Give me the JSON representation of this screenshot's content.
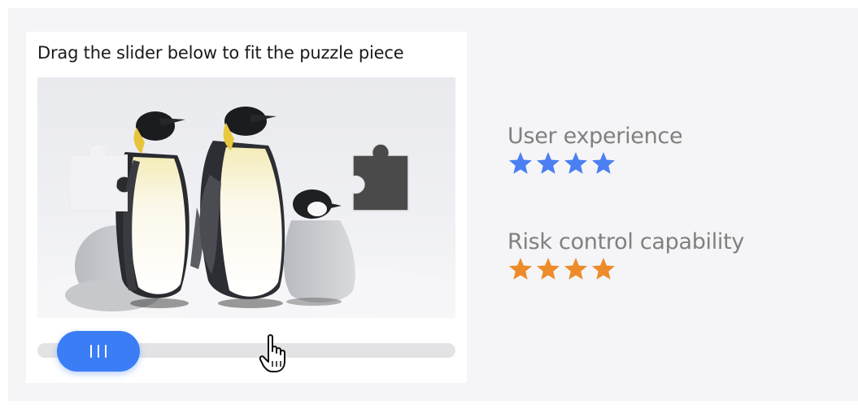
{
  "captcha": {
    "instruction": "Drag the slider below to fit the puzzle piece",
    "image_subject": "emperor-penguins-on-snow",
    "slider_position": 0
  },
  "ratings": [
    {
      "label": "User experience",
      "stars": 4,
      "color": "#4b7ff2"
    },
    {
      "label": "Risk control capability",
      "stars": 4,
      "color": "#ed8b2a"
    }
  ],
  "icons": {
    "cursor": "hand-pointer-icon",
    "grip": "grip-lines-icon",
    "star": "star-icon"
  }
}
